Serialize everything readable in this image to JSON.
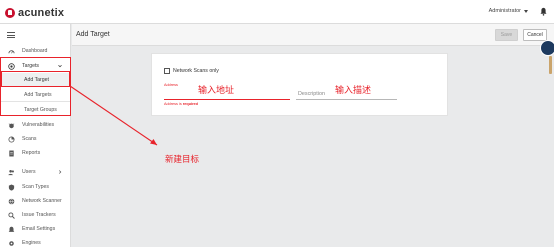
{
  "app": {
    "logo_text": "acunetix",
    "user": "Administrator"
  },
  "sidebar": {
    "items": [
      {
        "label": "Dashboard"
      },
      {
        "label": "Targets"
      },
      {
        "label": "Vulnerabilities"
      },
      {
        "label": "Scans"
      },
      {
        "label": "Reports"
      },
      {
        "label": "Users"
      },
      {
        "label": "Scan Types"
      },
      {
        "label": "Network Scanner"
      },
      {
        "label": "Issue Trackers"
      },
      {
        "label": "Email Settings"
      },
      {
        "label": "Engines"
      }
    ],
    "target_subitems": [
      {
        "label": "Add Target"
      },
      {
        "label": "Add Targets"
      },
      {
        "label": "Target Groups"
      }
    ]
  },
  "header": {
    "title": "Add Target",
    "save_label": "Save",
    "cancel_label": "Cancel"
  },
  "form": {
    "network_scans_label": "Network Scans only",
    "address_label": "Address",
    "address_error_prefix": "Address is",
    "address_error_word": "required",
    "description_placeholder": "Description"
  },
  "annotations": {
    "address_hint": "输入地址",
    "description_hint": "输入描述",
    "new_target_note": "新建目标"
  },
  "colors": {
    "brand": "#c8102e",
    "annotation": "#e8232b",
    "help_badge": "#1d3a5f"
  },
  "icons": [
    "menu-icon",
    "dashboard-icon",
    "target-icon",
    "vulnerability-icon",
    "scans-icon",
    "reports-icon",
    "users-icon",
    "scan-types-icon",
    "network-scanner-icon",
    "issue-trackers-icon",
    "email-settings-icon",
    "engines-icon",
    "bell-icon"
  ]
}
